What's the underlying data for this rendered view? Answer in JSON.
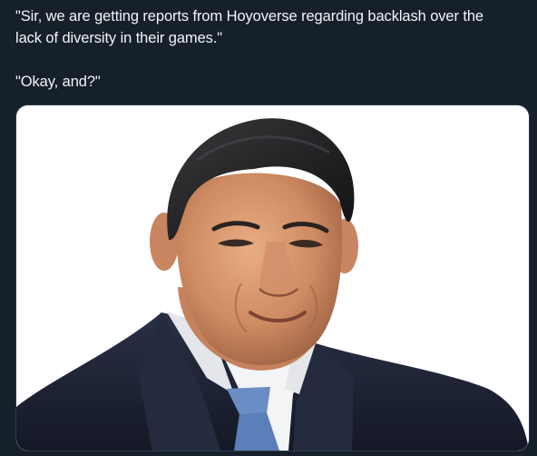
{
  "post": {
    "line_1": "\"Sir, we are getting reports from Hoyoverse regarding backlash over the",
    "line_2": "lack of diversity in their games.\"",
    "line_3": "\"Okay, and?\""
  },
  "media": {
    "background_color": "#ffffff",
    "suit_color": "#1e2436",
    "tie_color": "#5b7fb8"
  }
}
